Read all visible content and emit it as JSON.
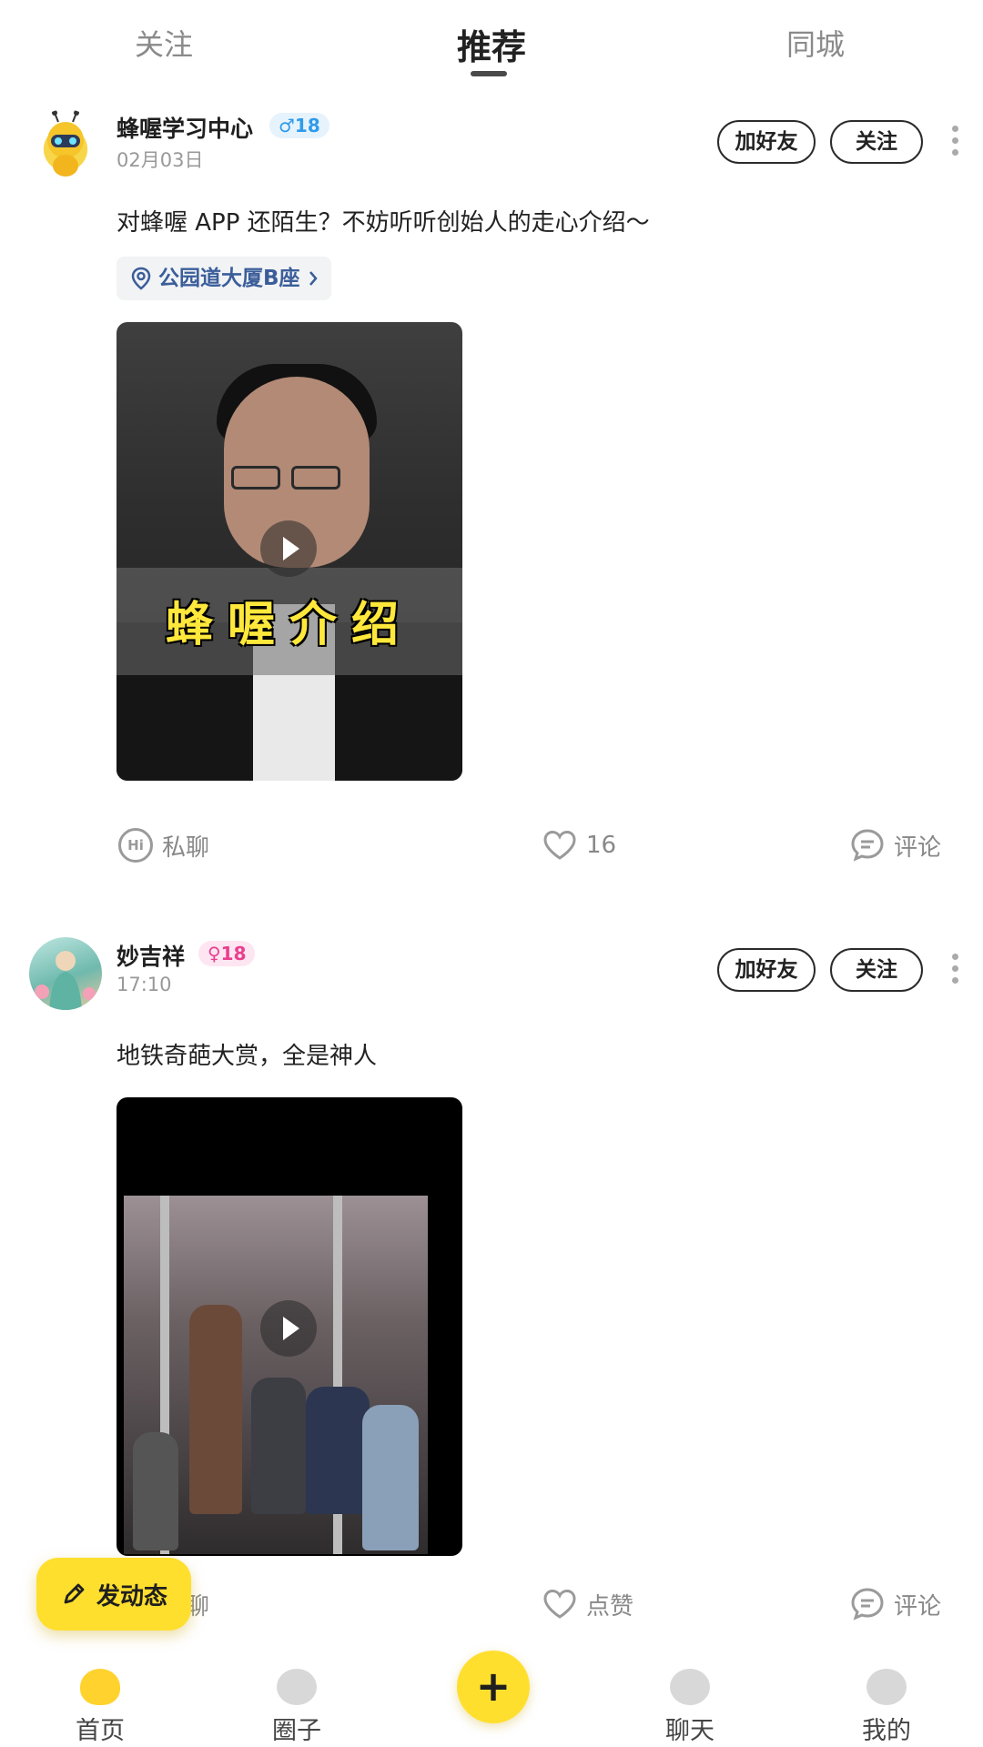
{
  "top_tabs": [
    "关注",
    "推荐",
    "同城"
  ],
  "posts": [
    {
      "username": "蜂喔学习中心",
      "gender_age": "♂18",
      "time": "02月03日",
      "add_friend": "加好友",
      "follow": "关注",
      "text": "对蜂喔 APP 还陌生？不妨听听创始人的走心介绍～",
      "location": "公园道大厦B座",
      "video_caption": "蜂喔介绍",
      "actions": {
        "chat": "私聊",
        "like": "16",
        "comment": "评论"
      }
    },
    {
      "username": "妙吉祥",
      "gender_age": "♀18",
      "time": "17:10",
      "add_friend": "加好友",
      "follow": "关注",
      "text": "地铁奇葩大赏，全是神人",
      "actions": {
        "chat": "私聊",
        "like": "点赞",
        "comment": "评论"
      }
    }
  ],
  "compose_button": "发动态",
  "bottom_nav": [
    "首页",
    "圈子",
    "+",
    "聊天",
    "我的"
  ],
  "colors": {
    "accent": "#ffdf2e",
    "link": "#3b5e9a",
    "male": "#2f9bea",
    "female": "#ea3f8f"
  },
  "icons": [
    "location-pin-icon",
    "chevron-right-icon",
    "play-icon",
    "hi-chat-icon",
    "heart-icon",
    "comment-icon",
    "more-dots-icon",
    "pen-icon",
    "plus-icon"
  ]
}
